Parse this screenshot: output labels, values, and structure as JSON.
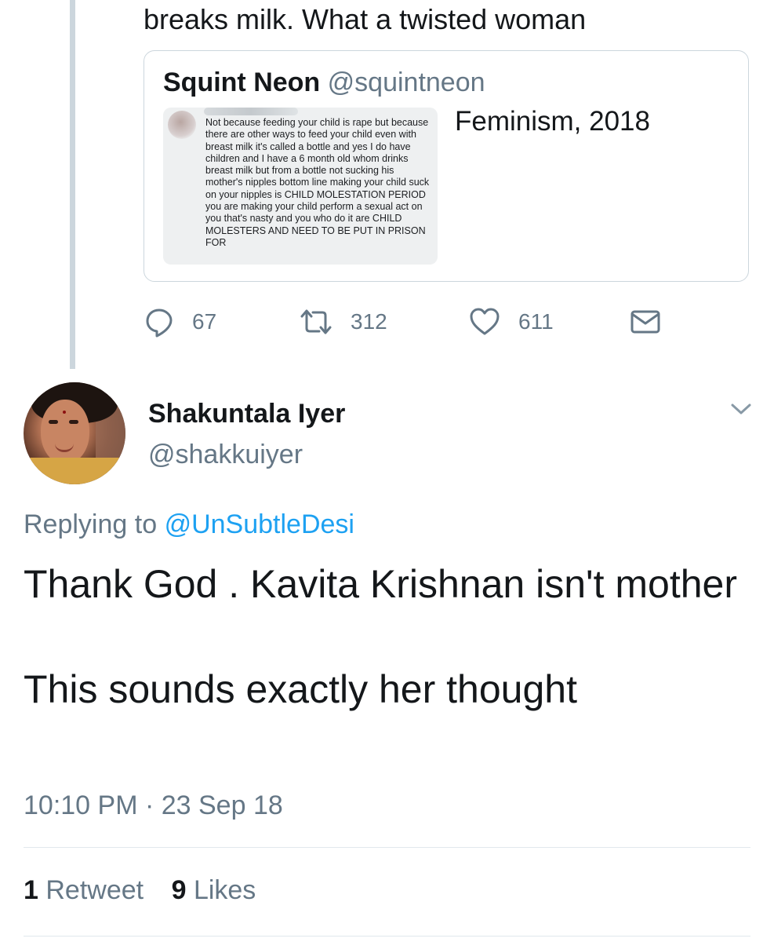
{
  "previous_tweet": {
    "text_tail": "breaks milk. What a twisted woman",
    "quoted": {
      "author_name": "Squint Neon",
      "author_handle": "@squintneon",
      "text": "Feminism, 2018",
      "image_text": "Not because feeding your child is rape but because there are other ways to feed your child even with breast milk it's called a bottle and yes I do have children and I have a 6 month old whom drinks breast milk but from a bottle not sucking his mother's nipples bottom line making your child suck on your nipples is CHILD MOLESTATION PERIOD you are making your child perform a sexual act on you that's nasty and you who do it are CHILD MOLESTERS AND NEED TO BE PUT IN PRISON FOR"
    },
    "actions": {
      "replies": "67",
      "retweets": "312",
      "likes": "611"
    }
  },
  "tweet": {
    "author_name": "Shakuntala Iyer",
    "author_handle": "@shakkuiyer",
    "replying_prefix": "Replying to",
    "replying_to": "@UnSubtleDesi",
    "paragraph1": "Thank God . Kavita Krishnan isn't mother",
    "paragraph2": "This sounds exactly her thought",
    "timestamp": "10:10 PM · 23 Sep 18",
    "retweet_count": "1",
    "retweet_label": "Retweet",
    "like_count": "9",
    "like_label": "Likes"
  },
  "icons": {
    "reply": "reply-icon",
    "retweet": "retweet-icon",
    "like": "heart-icon",
    "dm": "mail-icon",
    "menu": "chevron-down-icon"
  },
  "colors": {
    "text": "#14171a",
    "secondary": "#657786",
    "link": "#1da1f2",
    "border": "#ccd6dd"
  }
}
